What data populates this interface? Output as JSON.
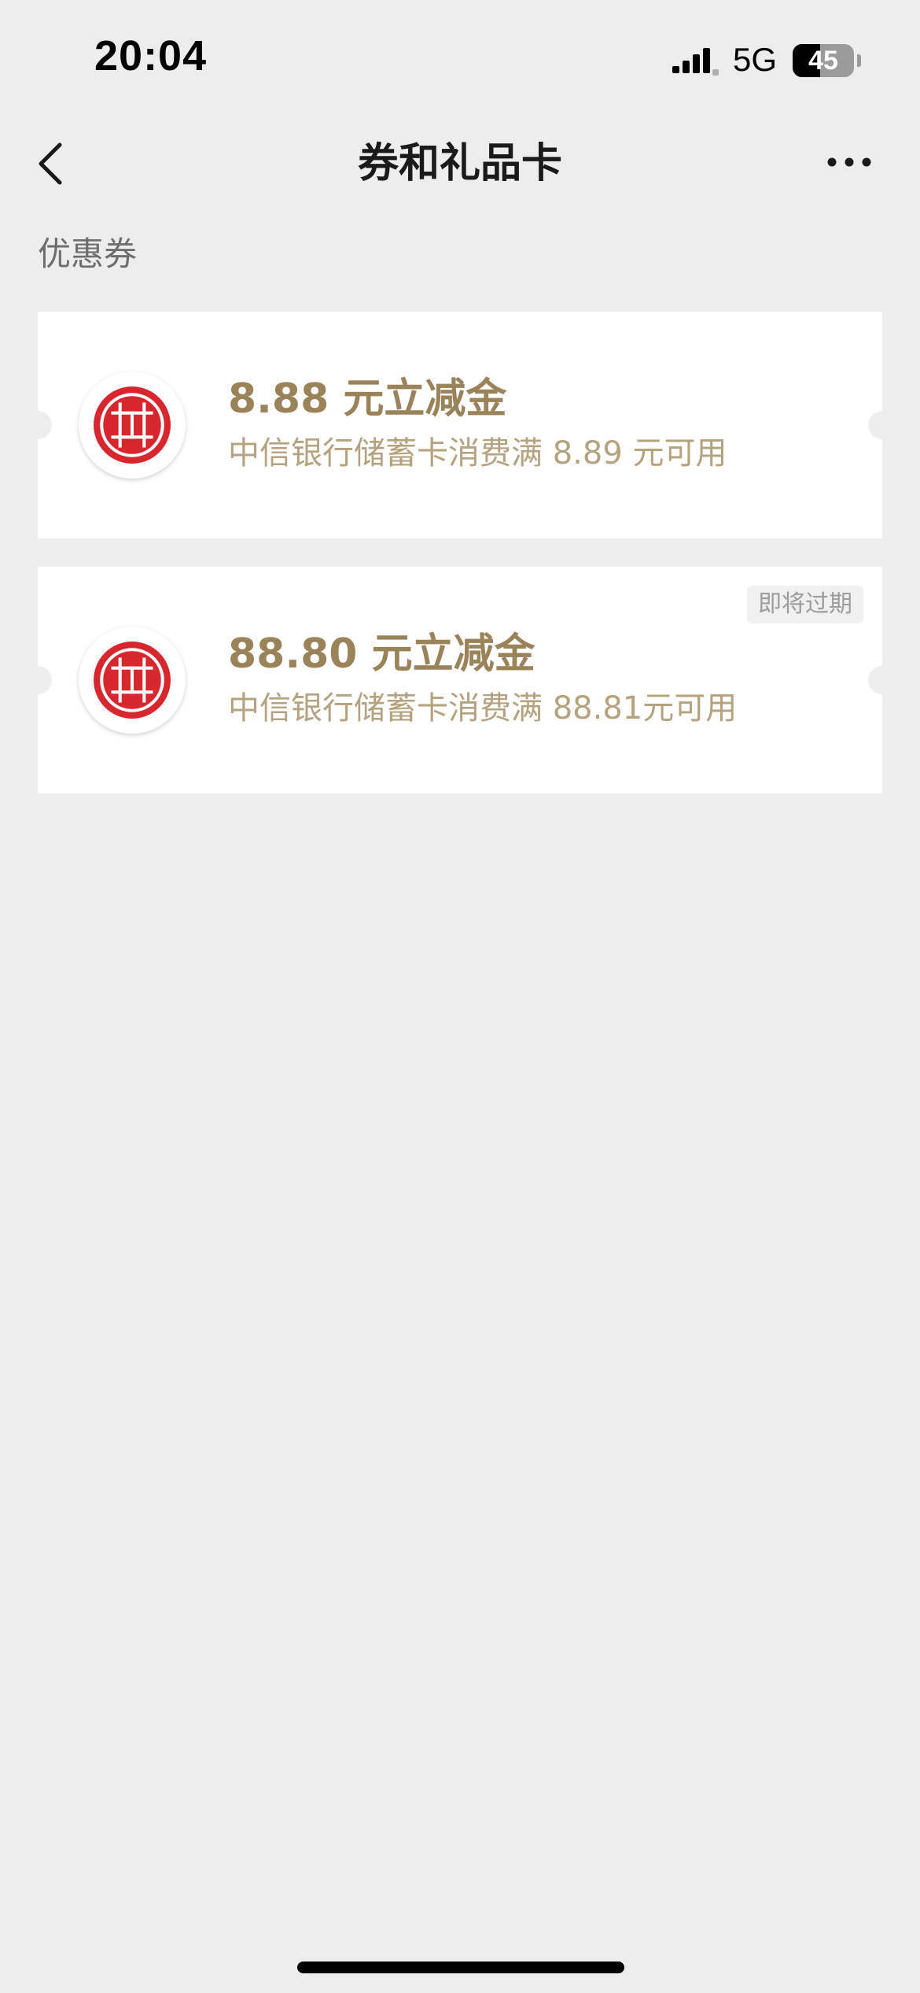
{
  "status_bar": {
    "time": "20:04",
    "network": "5G",
    "battery": "45",
    "battery_level": 0.45
  },
  "nav": {
    "title": "券和礼品卡"
  },
  "section": {
    "label": "优惠券"
  },
  "coupons": [
    {
      "title": "8.88 元立减金",
      "description": "中信银行储蓄卡消费满 8.89 元可用",
      "badge": ""
    },
    {
      "title": "88.80 元立减金",
      "description": "中信银行储蓄卡消费满 88.81元可用",
      "badge": "即将过期"
    }
  ],
  "colors": {
    "background": "#ededed",
    "card": "#ffffff",
    "coupon_title": "#9a8259",
    "coupon_desc": "#b5a27e",
    "citic_red": "#d7262e"
  },
  "icons": {
    "back": "chevron-left-icon",
    "more": "more-dots-icon",
    "signal": "signal-icon",
    "bank_logo": "citic-bank-logo"
  }
}
